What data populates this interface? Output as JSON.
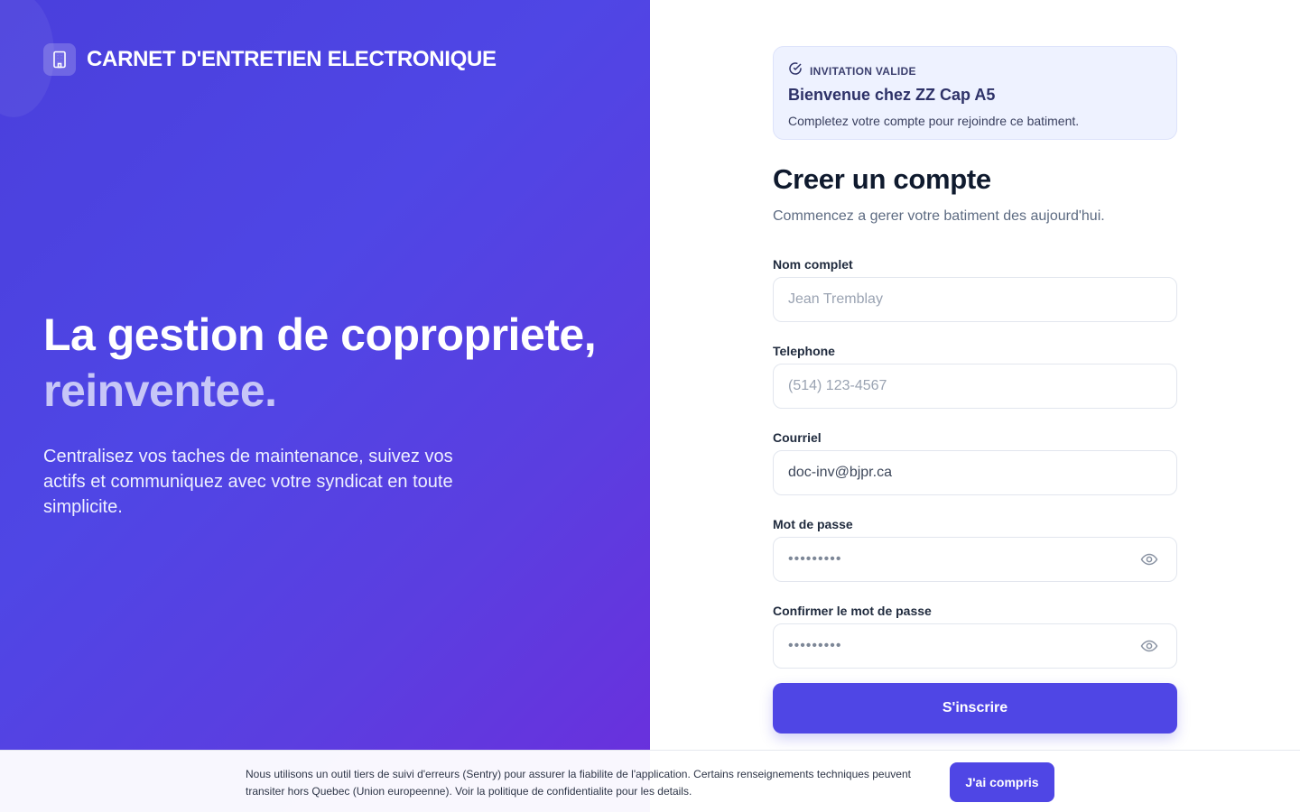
{
  "brand": {
    "name": "CARNET D'ENTRETIEN ELECTRONIQUE",
    "icon": "building-icon"
  },
  "hero": {
    "title_line1": "La gestion de copropriete,",
    "title_line2": "reinventee.",
    "description": "Centralisez vos taches de maintenance, suivez vos actifs et communiquez avec votre syndicat en toute simplicite."
  },
  "invite": {
    "tag": "INVITATION VALIDE",
    "title": "Bienvenue chez ZZ Cap A5",
    "subtitle": "Completez votre compte pour rejoindre ce batiment."
  },
  "form": {
    "title": "Creer un compte",
    "subtitle": "Commencez a gerer votre batiment des aujourd'hui.",
    "name_label": "Nom complet",
    "name_placeholder": "Jean Tremblay",
    "phone_label": "Telephone",
    "phone_placeholder": "(514) 123-4567",
    "email_label": "Courriel",
    "email_value": "doc-inv@bjpr.ca",
    "password_label": "Mot de passe",
    "password_dots": "•••••••••",
    "confirm_label": "Confirmer le mot de passe",
    "confirm_dots": "•••••••••",
    "submit_label": "S'inscrire"
  },
  "cookie": {
    "text": "Nous utilisons un outil tiers de suivi d'erreurs (Sentry) pour assurer la fiabilite de l'application. Certains renseignements techniques peuvent transiter hors Quebec (Union europeenne). Voir la politique de confidentialite pour les details.",
    "button_label": "J'ai compris"
  },
  "colors": {
    "accent": "#4f46e5",
    "highlight": "#c7c6f7",
    "invite_bg": "#eef2ff"
  }
}
